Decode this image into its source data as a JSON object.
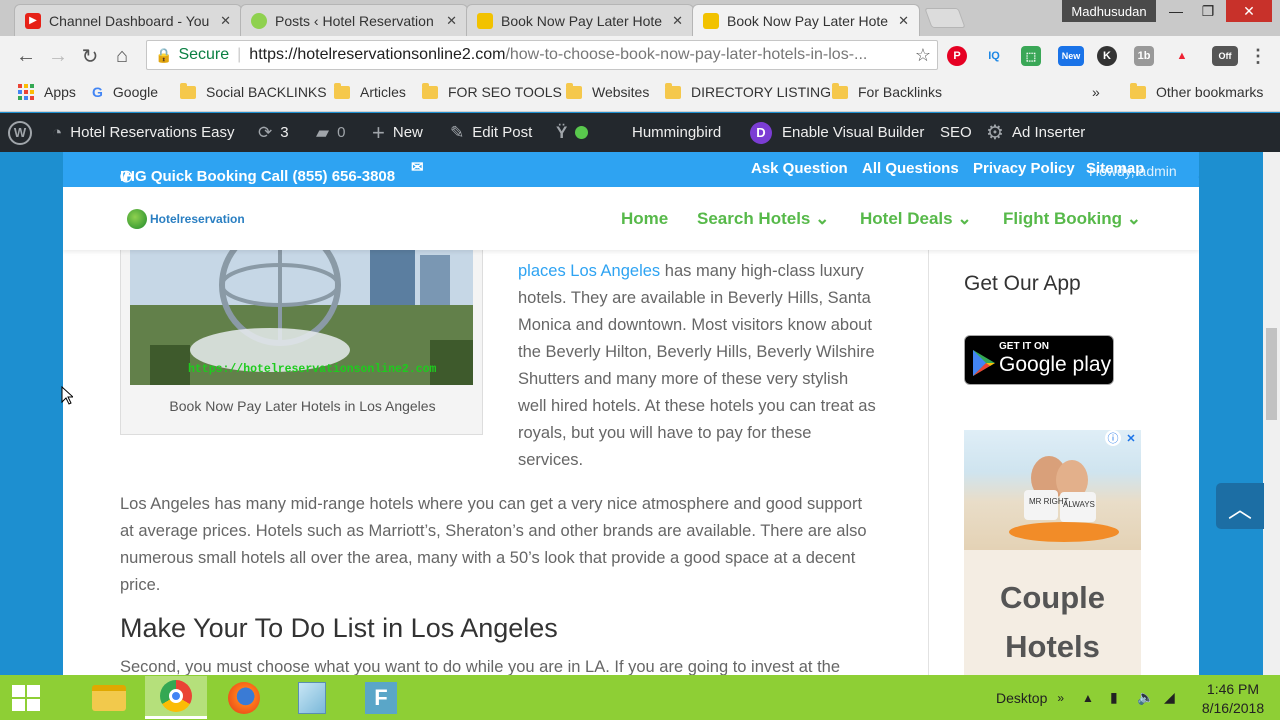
{
  "tabs": [
    {
      "title": "Channel Dashboard - You",
      "favicon": "youtube-icon"
    },
    {
      "title": "Posts ‹ Hotel Reservation",
      "favicon": "wordpress-icon"
    },
    {
      "title": "Book Now Pay Later Hote",
      "favicon": "hotel-icon"
    },
    {
      "title": "Book Now Pay Later Hote",
      "favicon": "hotel-icon"
    }
  ],
  "profile_name": "Madhusudan",
  "address": {
    "secure_label": "Secure",
    "host": "https://hotelreservationsonline2.com",
    "path": "/how-to-choose-book-now-pay-later-hotels-in-los-..."
  },
  "extensions": {
    "iq": "IQ",
    "new": "New",
    "k": "K",
    "tb": "1b",
    "off": "Off"
  },
  "bookmarks": {
    "apps": "Apps",
    "google": "Google",
    "items": [
      "Social BACKLINKS",
      "Articles",
      "FOR SEO TOOLS",
      "Websites",
      "DIRECTORY LISTING",
      "For Backlinks"
    ],
    "more": "»",
    "other": "Other bookmarks"
  },
  "wpbar": {
    "site_name": "Hotel Reservations Easy",
    "updates": "3",
    "comments": "0",
    "new": "New",
    "edit_post": "Edit Post",
    "hummingbird": "Hummingbird",
    "visual_builder": "Enable Visual Builder",
    "seo": "SEO",
    "ad_inserter": "Ad Inserter",
    "howdy": "Howdy, admin"
  },
  "site": {
    "phone": "IHG Quick Booking Call (855) 656-3808",
    "top_links": [
      "Ask Question",
      "All Questions",
      "Privacy Policy",
      "Sitemap"
    ],
    "logo_text": "Hotelreservation",
    "nav": [
      "Home",
      "Search Hotels",
      "Hotel Deals",
      "Flight Booking"
    ],
    "photo_watermark": "https://hotelreservationsonline2.com",
    "caption": "Book Now Pay Later Hotels in Los Angeles",
    "para1_link": "places Los Angeles",
    "para1_rest": " has many high-class luxury hotels. They are available in Beverly Hills, Santa Monica and downtown. Most visitors know about the Beverly Hilton, Beverly Hills, Beverly Wilshire Shutters and many more of these very stylish well hired hotels. At these hotels you can treat as royals, but you will have to pay for these services.",
    "para2": "Los Angeles has many mid-range hotels where you can get a very nice atmosphere and good support at average prices. Hotels such as Marriott’s, Sheraton’s and other brands are available. There are also numerous small hotels all over the area, many with a 50’s look that provide a good space at a decent price.",
    "heading": "Make Your To Do List in Los Angeles",
    "para3": "Second, you must choose what you want to do while you are in LA. If you are going to invest at the",
    "sidebar_title": "Get Our App",
    "gplay_small": "GET IT ON",
    "gplay_big": "Google play",
    "ad_line1": "Couple",
    "ad_line2": "Hotels",
    "ad_pillow1": "MR RIGHT",
    "ad_pillow2": "ALWAYS"
  },
  "taskbar": {
    "desktop_label": "Desktop",
    "time": "1:46 PM",
    "date": "8/16/2018",
    "apps": [
      "file-explorer-icon",
      "chrome-icon",
      "firefox-icon",
      "notepad-icon",
      "f-app-icon"
    ]
  },
  "colors": {
    "wp_admin": "#23282d",
    "site_topbar": "#2ea3f2",
    "nav_green": "#57b94a",
    "taskbar": "#8ecf35",
    "page_bg": "#1d8fd0"
  }
}
